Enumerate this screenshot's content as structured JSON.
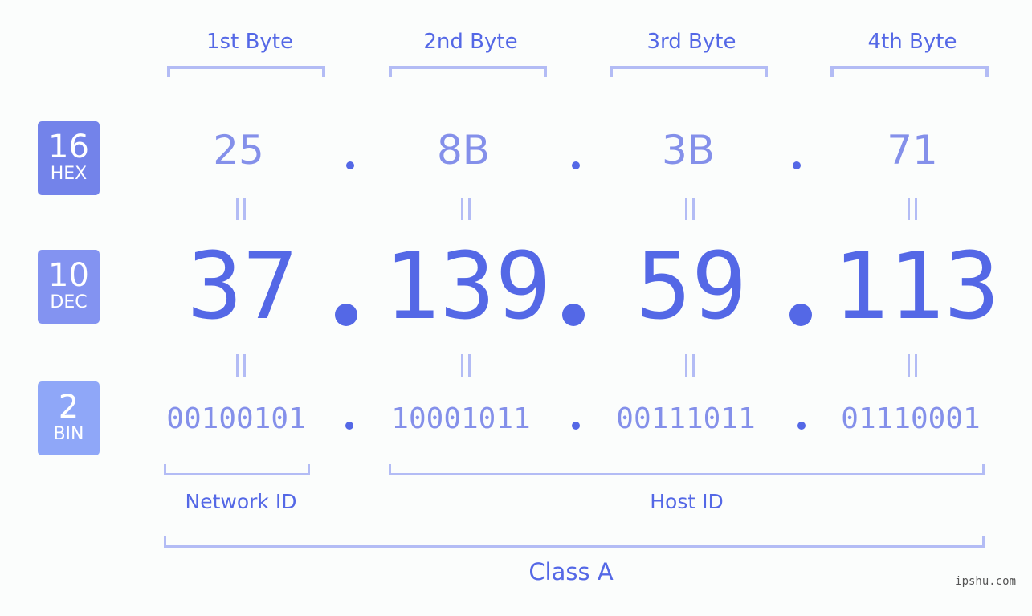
{
  "badges": [
    {
      "base": "16",
      "name": "HEX",
      "color": "#7383ea"
    },
    {
      "base": "10",
      "name": "DEC",
      "color": "#8393f1"
    },
    {
      "base": "2",
      "name": "BIN",
      "color": "#8fa7f8"
    }
  ],
  "byte_headers": [
    "1st Byte",
    "2nd Byte",
    "3rd Byte",
    "4th Byte"
  ],
  "hex": [
    "25",
    "8B",
    "3B",
    "71"
  ],
  "dec": [
    "37",
    "139",
    "59",
    "113"
  ],
  "bin": [
    "00100101",
    "10001011",
    "00111011",
    "01110001"
  ],
  "separator": ".",
  "network_label": "Network ID",
  "host_label": "Host ID",
  "class_label": "Class A",
  "watermark": "ipshu.com",
  "colors": {
    "accent": "#5468e6",
    "light": "#8490ea",
    "bracket": "#b3bcf5"
  }
}
